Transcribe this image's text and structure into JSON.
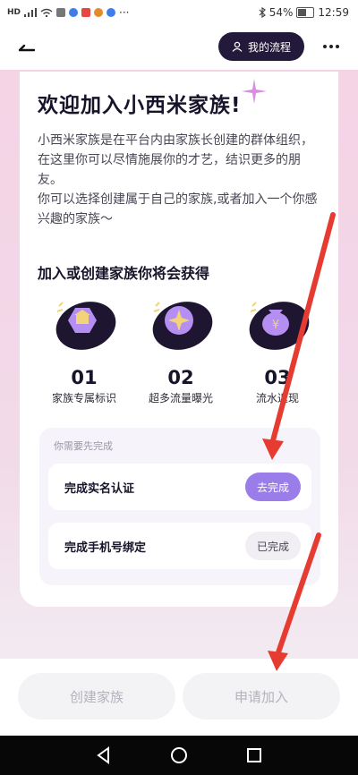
{
  "status_bar": {
    "battery_percent": "54%",
    "time": "12:59",
    "overflow": "···"
  },
  "header": {
    "back_icon": "arrow-left-icon",
    "process_button_label": "我的流程",
    "process_icon": "person-icon",
    "more_icon": "more-dots-icon"
  },
  "main": {
    "title": "欢迎加入小西米家族!",
    "description": [
      "小西米家族是在平台内由家族长创建的群体组织，在这里你可以尽情施展你的才艺，结识更多的朋友。",
      "你可以选择创建属于自己的家族,或者加入一个你感兴趣的家族～"
    ],
    "benefits_title": "加入或创建家族你将会获得",
    "benefits": [
      {
        "number": "01",
        "label": "家族专属标识",
        "icon": "bank-badge-icon"
      },
      {
        "number": "02",
        "label": "超多流量曝光",
        "icon": "burst-star-icon"
      },
      {
        "number": "03",
        "label": "流水返现",
        "icon": "money-bag-icon"
      }
    ],
    "tasks_hint": "你需要先完成",
    "tasks": [
      {
        "label": "完成实名认证",
        "action": "去完成"
      },
      {
        "label": "完成手机号绑定",
        "action": "已完成"
      }
    ]
  },
  "footer": {
    "create_button": "创建家族",
    "join_button": "申请加入"
  },
  "colors": {
    "accent_dark": "#231a3b",
    "accent_purple": "#9a7de8",
    "annotation_red": "#e53b30"
  }
}
